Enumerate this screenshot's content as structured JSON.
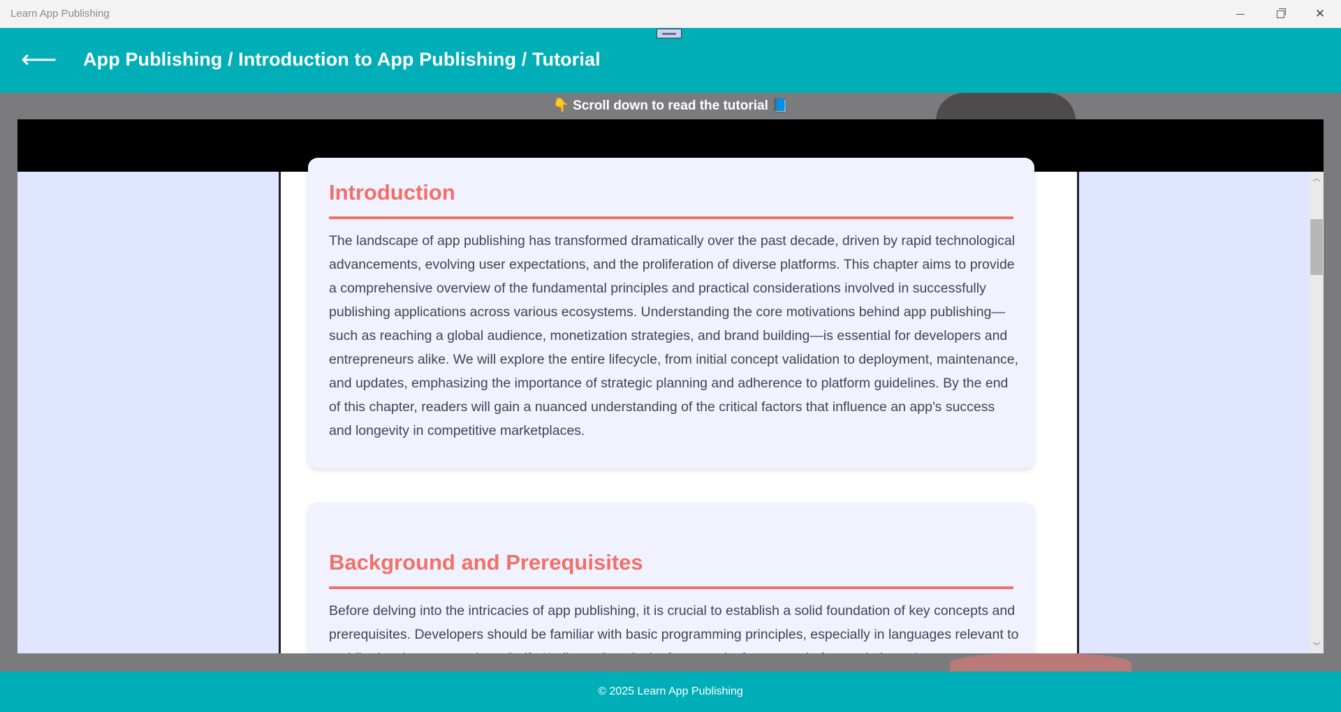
{
  "window": {
    "title": "Learn App Publishing",
    "minimize_icon": "minimize-icon",
    "maximize_icon": "restore-icon",
    "close_icon": "close-icon",
    "close_glyph": "✕"
  },
  "header": {
    "back_glyph": "⟵",
    "breadcrumb": "App Publishing / Introduction to App Publishing / Tutorial",
    "background_color": "#00aeb7"
  },
  "hint": {
    "text": "👇 Scroll down to read the tutorial 📘"
  },
  "sections": [
    {
      "heading": "Introduction",
      "body": "The landscape of app publishing has transformed dramatically over the past decade, driven by rapid technological advancements, evolving user expectations, and the proliferation of diverse platforms. This chapter aims to provide a comprehensive overview of the fundamental principles and practical considerations involved in successfully publishing applications across various ecosystems. Understanding the core motivations behind app publishing—such as reaching a global audience, monetization strategies, and brand building—is essential for developers and entrepreneurs alike. We will explore the entire lifecycle, from initial concept validation to deployment, maintenance, and updates, emphasizing the importance of strategic planning and adherence to platform guidelines. By the end of this chapter, readers will gain a nuanced understanding of the critical factors that influence an app's success and longevity in competitive marketplaces."
    },
    {
      "heading": "Background and Prerequisites",
      "body": "Before delving into the intricacies of app publishing, it is crucial to establish a solid foundation of key concepts and prerequisites. Developers should be familiar with basic programming principles, especially in languages relevant to mobile development such as Swift, Kotlin, or JavaScript frameworks for cross-platform solutions. An"
    }
  ],
  "scrollbar": {
    "up_glyph": "︿",
    "down_glyph": "﹀"
  },
  "footer": {
    "text": "© 2025 Learn App Publishing"
  },
  "colors": {
    "accent": "#00aeb7",
    "heading": "#f07068",
    "card_bg": "#f0f3ff",
    "frame_bg": "#e0e6ff"
  }
}
